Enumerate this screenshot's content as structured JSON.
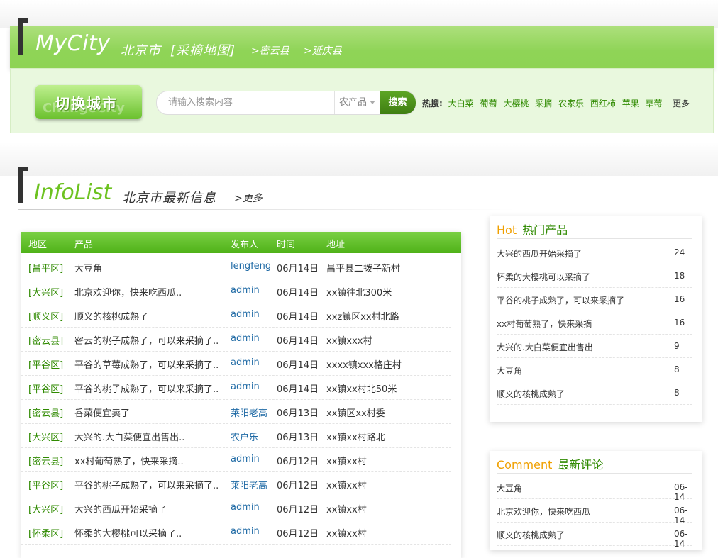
{
  "header": {
    "logo": "MyCity",
    "city": "北京市",
    "map_label": "[采摘地图]",
    "counties": [
      ">密云县",
      ">延庆县"
    ]
  },
  "toolbar": {
    "switch_city_label": "切换城市",
    "switch_city_watermark": "ChangeCity",
    "search_placeholder": "请输入搜索内容",
    "search_category": "农产品",
    "search_button": "搜索",
    "hot_label": "热搜:",
    "hot_keywords": [
      "大白菜",
      "葡萄",
      "大樱桃",
      "采摘",
      "农家乐",
      "西红柿",
      "苹果",
      "草莓"
    ],
    "more_label": "更多"
  },
  "infolist": {
    "title": "InfoList",
    "subtitle": "北京市最新信息",
    "more": ">更多",
    "columns": [
      "地区",
      "产品",
      "发布人",
      "时间",
      "地址"
    ],
    "rows": [
      {
        "area": "[昌平区]",
        "product": "大豆角",
        "user": "lengfeng",
        "date": "06月14日",
        "address": "昌平县二拨子新村"
      },
      {
        "area": "[大兴区]",
        "product": "北京欢迎你，快来吃西瓜..",
        "user": "admin",
        "date": "06月14日",
        "address": "xx镇往北300米"
      },
      {
        "area": "[顺义区]",
        "product": "顺义的核桃成熟了",
        "user": "admin",
        "date": "06月14日",
        "address": "xxz镇区xx村北路"
      },
      {
        "area": "[密云县]",
        "product": "密云的桃子成熟了，可以来采摘了..",
        "user": "admin",
        "date": "06月14日",
        "address": "xx镇xxx村"
      },
      {
        "area": "[平谷区]",
        "product": "平谷的草莓成熟了，可以来采摘了..",
        "user": "admin",
        "date": "06月14日",
        "address": "xxxx镇xxx格庄村"
      },
      {
        "area": "[平谷区]",
        "product": "平谷的桃子成熟了，可以来采摘了..",
        "user": "admin",
        "date": "06月14日",
        "address": "xx镇xx村北50米"
      },
      {
        "area": "[密云县]",
        "product": "香菜便宜卖了",
        "user": "莱阳老高",
        "date": "06月13日",
        "address": "xx镇区xx村委"
      },
      {
        "area": "[大兴区]",
        "product": "大兴的.大白菜便宜出售出..",
        "user": "农户乐",
        "date": "06月13日",
        "address": "xx镇xx村路北"
      },
      {
        "area": "[密云县]",
        "product": "xx村葡萄熟了，快来采摘..",
        "user": "admin",
        "date": "06月12日",
        "address": "xx镇xx村"
      },
      {
        "area": "[平谷区]",
        "product": "平谷的桃子成熟了，可以来采摘了..",
        "user": "莱阳老高",
        "date": "06月12日",
        "address": "xx镇xx村"
      },
      {
        "area": "[大兴区]",
        "product": "大兴的西瓜开始采摘了",
        "user": "admin",
        "date": "06月12日",
        "address": "xx镇xx村"
      },
      {
        "area": "[怀柔区]",
        "product": "怀柔的大樱桃可以采摘了..",
        "user": "admin",
        "date": "06月12日",
        "address": "xx镇xx村"
      }
    ]
  },
  "hot": {
    "title_en": "Hot",
    "title_zh": "热门产品",
    "items": [
      {
        "text": "大兴的西瓜开始采摘了",
        "count": "24"
      },
      {
        "text": "怀柔的大樱桃可以采摘了",
        "count": "18"
      },
      {
        "text": "平谷的桃子成熟了，可以来采摘了",
        "count": "16"
      },
      {
        "text": "xx村葡萄熟了，快来采摘",
        "count": "16"
      },
      {
        "text": "大兴的.大白菜便宜出售出",
        "count": "9"
      },
      {
        "text": "大豆角",
        "count": "8"
      },
      {
        "text": "顺义的核桃成熟了",
        "count": "8"
      }
    ]
  },
  "comment": {
    "title_en": "Comment",
    "title_zh": "最新评论",
    "items": [
      {
        "text": "大豆角",
        "date": "06-14"
      },
      {
        "text": "北京欢迎你，快来吃西瓜",
        "date": "06-14"
      },
      {
        "text": "顺义的核桃成熟了",
        "date": "06-14"
      }
    ]
  },
  "colors": {
    "brand_green": "#8fd457",
    "link_green": "#2f8a00",
    "user_blue": "#1f6aa5",
    "accent_orange": "#f0a000"
  }
}
